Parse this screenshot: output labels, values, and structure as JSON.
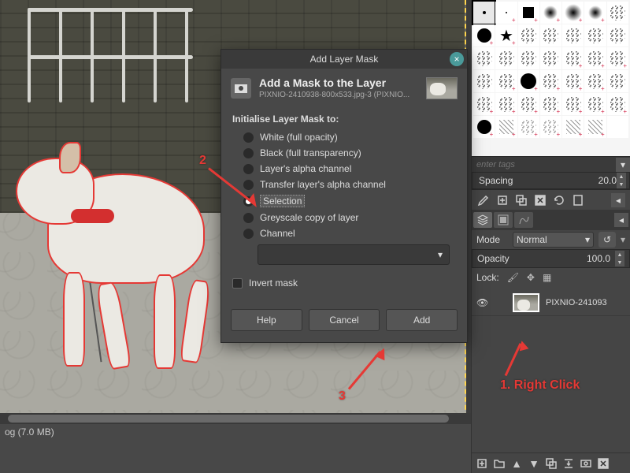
{
  "status_bar": "og (7.0 MB)",
  "brushes": {
    "tags_placeholder": "enter tags",
    "spacing_label": "Spacing",
    "spacing_value": "20.0"
  },
  "layers_panel": {
    "mode_label": "Mode",
    "mode_value": "Normal",
    "opacity_label": "Opacity",
    "opacity_value": "100.0",
    "lock_label": "Lock:",
    "layer_name": "PIXNIO-241093"
  },
  "dialog": {
    "title": "Add Layer Mask",
    "header_main": "Add a Mask to the Layer",
    "header_sub": "PIXNIO-2410938-800x533.jpg-3 (PIXNIO...",
    "prompt": "Initialise Layer Mask to:",
    "options": [
      "White (full opacity)",
      "Black (full transparency)",
      "Layer's alpha channel",
      "Transfer layer's alpha channel",
      "Selection",
      "Greyscale copy of layer",
      "Channel"
    ],
    "invert_label": "Invert mask",
    "btn_help": "Help",
    "btn_cancel": "Cancel",
    "btn_add": "Add"
  },
  "annotations": {
    "step1": "1. Right Click",
    "step2": "2",
    "step3": "3"
  }
}
